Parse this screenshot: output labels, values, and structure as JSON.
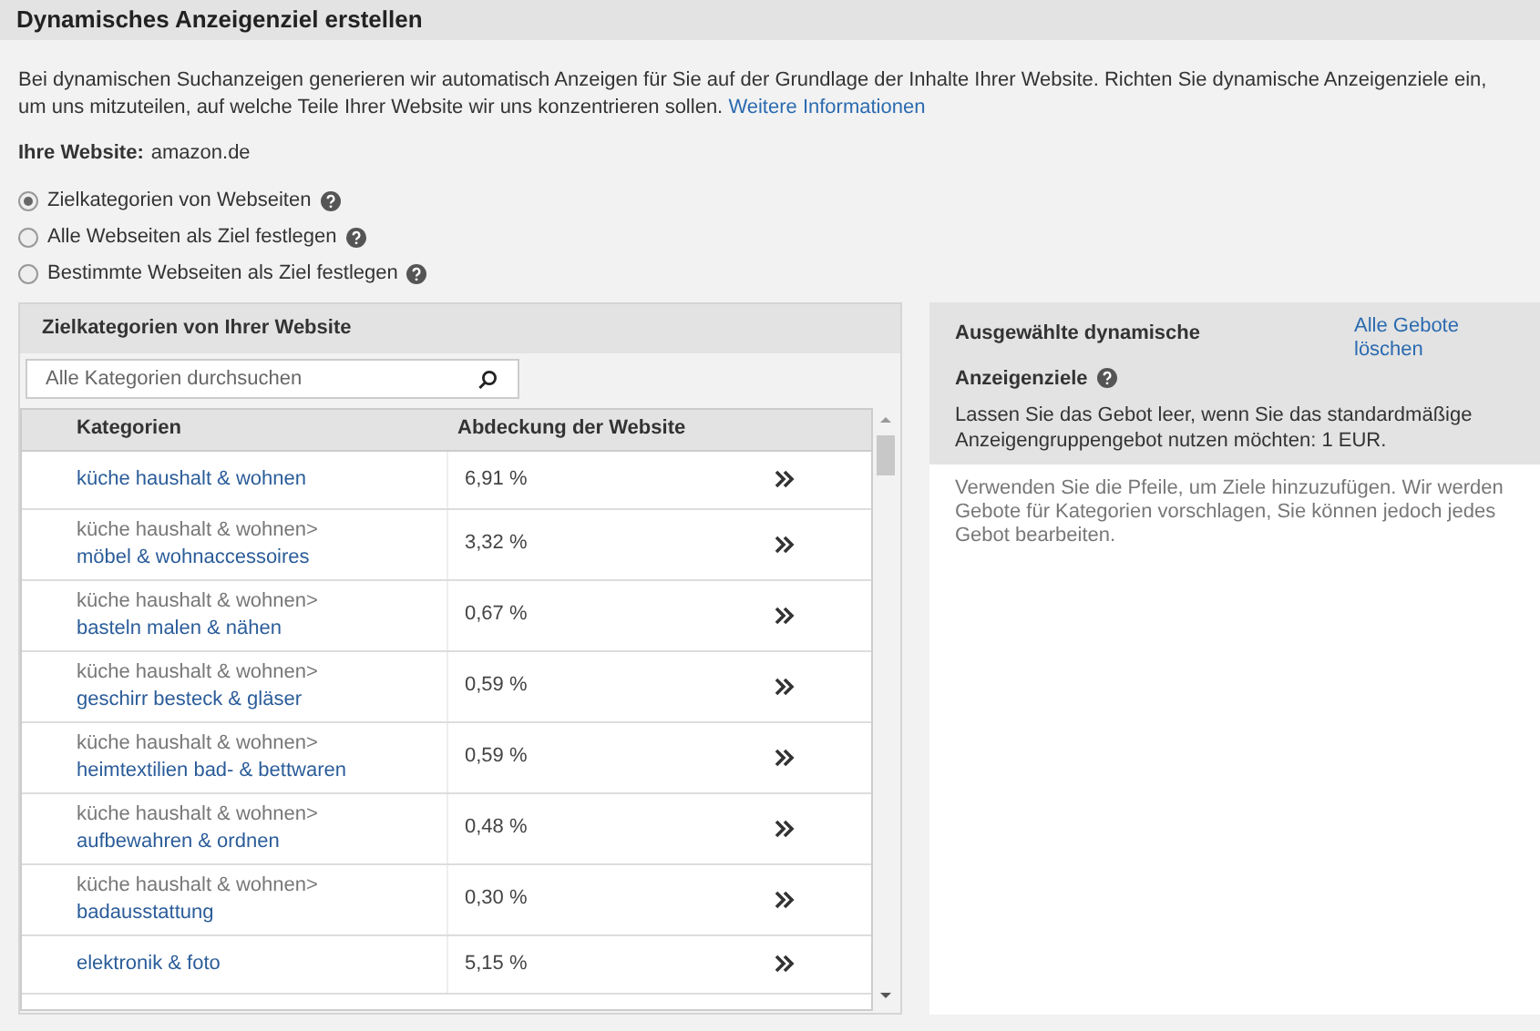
{
  "title": "Dynamisches Anzeigenziel erstellen",
  "intro": {
    "text": "Bei dynamischen Suchanzeigen generieren wir automatisch Anzeigen für Sie auf der Grundlage der Inhalte Ihrer Website. Richten Sie dynamische Anzeigenziele ein, um uns mitzuteilen, auf welche Teile Ihrer Website wir uns konzentrieren sollen.",
    "link": "Weitere Informationen"
  },
  "website": {
    "label": "Ihre Website:",
    "value": "amazon.de"
  },
  "options": [
    {
      "label": "Zielkategorien von Webseiten",
      "selected": true
    },
    {
      "label": "Alle Webseiten als Ziel festlegen",
      "selected": false
    },
    {
      "label": "Bestimmte Webseiten als Ziel festlegen",
      "selected": false
    }
  ],
  "left_panel": {
    "title": "Zielkategorien von Ihrer Website",
    "search": {
      "placeholder": "Alle Kategorien durchsuchen"
    },
    "table": {
      "columns": [
        "Kategorien",
        "Abdeckung der Website"
      ],
      "rows": [
        {
          "category": "küche haushalt & wohnen",
          "coverage": "6,91 %"
        },
        {
          "parent": "küche haushalt & wohnen>",
          "category": "möbel & wohnaccessoires",
          "coverage": "3,32 %"
        },
        {
          "parent": "küche haushalt & wohnen>",
          "category": "basteln malen & nähen",
          "coverage": "0,67 %"
        },
        {
          "parent": "küche haushalt & wohnen>",
          "category": "geschirr besteck & gläser",
          "coverage": "0,59 %"
        },
        {
          "parent": "küche haushalt & wohnen>",
          "category": "heimtextilien bad- & bettwaren",
          "coverage": "0,59 %"
        },
        {
          "parent": "küche haushalt & wohnen>",
          "category": "aufbewahren & ordnen",
          "coverage": "0,48 %"
        },
        {
          "parent": "küche haushalt & wohnen>",
          "category": "badausstattung",
          "coverage": "0,30 %"
        },
        {
          "category": "elektronik & foto",
          "coverage": "5,15 %"
        }
      ]
    }
  },
  "right_panel": {
    "title_line_1": "Ausgewählte dynamische",
    "clear_link": "Alle Gebote löschen",
    "title_line_2": "Anzeigenziele",
    "note": "Lassen Sie das Gebot leer, wenn Sie das standardmäßige Anzeigengruppengebot nutzen möchten: 1 EUR.",
    "hint": "Verwenden Sie die Pfeile, um Ziele hinzuzufügen. Wir werden Gebote für Kategorien vorschlagen, Sie können jedoch jedes Gebot bearbeiten."
  }
}
